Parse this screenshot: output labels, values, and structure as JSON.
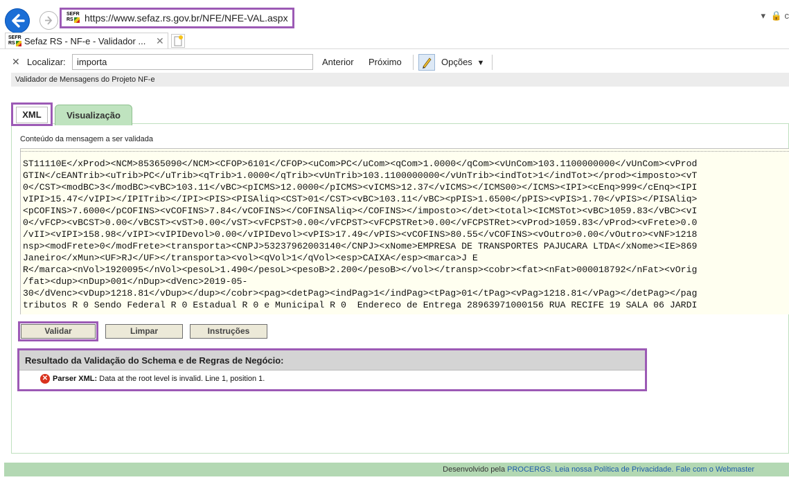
{
  "browser": {
    "url": "https://www.sefaz.rs.gov.br/NFE/NFE-VAL.aspx",
    "favicon_text": [
      "SEFR",
      "RS"
    ],
    "tab_title": "Sefaz RS - NF-e - Validador ...",
    "find": {
      "label": "Localizar:",
      "value": "importa",
      "prev": "Anterior",
      "next": "Próximo",
      "options": "Opções"
    }
  },
  "page": {
    "header": "Validador de Mensagens do Projeto NF-e",
    "tabs": [
      "XML",
      "Visualização"
    ],
    "content_label": "Conteúdo da mensagem a ser validada",
    "xml_lines": [
      "ST11110E</xProd><NCM>85365090</NCM><CFOP>6101</CFOP><uCom>PC</uCom><qCom>1.0000</qCom><vUnCom>103.1100000000</vUnCom><vProd",
      "GTIN</cEANTrib><uTrib>PC</uTrib><qTrib>1.0000</qTrib><vUnTrib>103.1100000000</vUnTrib><indTot>1</indTot></prod><imposto><vT",
      "0</CST><modBC>3</modBC><vBC>103.11</vBC><pICMS>12.0000</pICMS><vICMS>12.37</vICMS></ICMS00></ICMS><IPI><cEnq>999</cEnq><IPI",
      "vIPI>15.47</vIPI></IPITrib></IPI><PIS><PISAliq><CST>01</CST><vBC>103.11</vBC><pPIS>1.6500</pPIS><vPIS>1.70</vPIS></PISAliq>",
      "<pCOFINS>7.6000</pCOFINS><vCOFINS>7.84</vCOFINS></COFINSAliq></COFINS></imposto></det><total><ICMSTot><vBC>1059.83</vBC><vI",
      "0</vFCP><vBCST>0.00</vBCST><vST>0.00</vST><vFCPST>0.00</vFCPST><vFCPSTRet>0.00</vFCPSTRet><vProd>1059.83</vProd><vFrete>0.0",
      "/vII><vIPI>158.98</vIPI><vIPIDevol>0.00</vIPIDevol><vPIS>17.49</vPIS><vCOFINS>80.55</vCOFINS><vOutro>0.00</vOutro><vNF>1218",
      "nsp><modFrete>0</modFrete><transporta><CNPJ>53237962003140</CNPJ><xNome>EMPRESA DE TRANSPORTES PAJUCARA LTDA</xNome><IE>869",
      "Janeiro</xMun><UF>RJ</UF></transporta><vol><qVol>1</qVol><esp>CAIXA</esp><marca>J E",
      "R</marca><nVol>1920095</nVol><pesoL>1.490</pesoL><pesoB>2.200</pesoB></vol></transp><cobr><fat><nFat>000018792</nFat><vOrig",
      "/fat><dup><nDup>001</nDup><dVenc>2019-05-",
      "30</dVenc><vDup>1218.81</vDup></dup></cobr><pag><detPag><indPag>1</indPag><tPag>01</tPag><vPag>1218.81</vPag></detPag></pag",
      "tributos R 0 Sendo Federal R 0 Estadual R 0 e Municipal R 0  Endereco de Entrega 28963971000156 RUA RECIFE 19 SALA 06 JARDI"
    ],
    "buttons": {
      "validar": "Validar",
      "limpar": "Limpar",
      "instrucoes": "Instruções"
    },
    "result": {
      "title": "Resultado da Validação do Schema e de Regras de Negócio:",
      "error_label": "Parser XML:",
      "error_message": "Data at the root level is invalid. Line 1, position 1."
    },
    "footer": {
      "prefix": "Desenvolvido pela",
      "procergs": "PROCERGS.",
      "privacy": "Leia nossa Política de Privacidade.",
      "webmaster": "Fale com o Webmaster"
    }
  }
}
